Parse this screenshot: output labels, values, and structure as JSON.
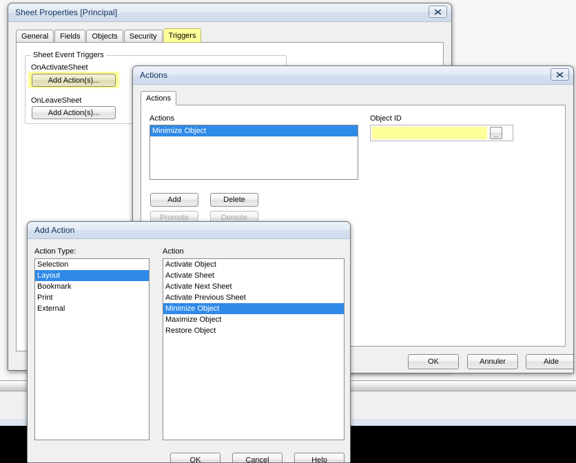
{
  "sheet_properties": {
    "title": "Sheet Properties [Principal]",
    "close_icon": "close-icon",
    "tabs": [
      {
        "label": "General",
        "selected": false,
        "highlight": false
      },
      {
        "label": "Fields",
        "selected": false,
        "highlight": false
      },
      {
        "label": "Objects",
        "selected": false,
        "highlight": false
      },
      {
        "label": "Security",
        "selected": false,
        "highlight": false
      },
      {
        "label": "Triggers",
        "selected": true,
        "highlight": true
      }
    ],
    "group_title": "Sheet Event Triggers",
    "triggers": [
      {
        "label": "OnActivateSheet",
        "button": "Add Action(s)...",
        "highlight": true
      },
      {
        "label": "OnLeaveSheet",
        "button": "Add Action(s)...",
        "highlight": false
      }
    ]
  },
  "actions_dialog": {
    "title": "Actions",
    "close_icon": "close-icon",
    "tabs": [
      {
        "label": "Actions",
        "selected": true
      }
    ],
    "actions_label": "Actions",
    "actions_list": [
      {
        "label": "Minimize Object",
        "selected": true
      }
    ],
    "object_id_label": "Object ID",
    "object_id_value": "",
    "object_id_placeholder": "",
    "browse_button": "...",
    "buttons": [
      {
        "label": "Add",
        "enabled": true
      },
      {
        "label": "Delete",
        "enabled": true
      },
      {
        "label": "Promote",
        "enabled": false
      },
      {
        "label": "Demote",
        "enabled": false
      }
    ],
    "footer_buttons": [
      {
        "label": "OK"
      },
      {
        "label": "Annuler"
      },
      {
        "label": "Aide"
      }
    ]
  },
  "add_action_dialog": {
    "title": "Add Action",
    "action_type_label": "Action Type:",
    "action_label": "Action",
    "action_types": [
      {
        "label": "Selection",
        "selected": false
      },
      {
        "label": "Layout",
        "selected": true
      },
      {
        "label": "Bookmark",
        "selected": false
      },
      {
        "label": "Print",
        "selected": false
      },
      {
        "label": "External",
        "selected": false
      }
    ],
    "actions": [
      {
        "label": "Activate Object",
        "selected": false
      },
      {
        "label": "Activate Sheet",
        "selected": false
      },
      {
        "label": "Activate Next Sheet",
        "selected": false
      },
      {
        "label": "Activate Previous Sheet",
        "selected": false
      },
      {
        "label": "Minimize Object",
        "selected": true
      },
      {
        "label": "Maximize Object",
        "selected": false
      },
      {
        "label": "Restore Object",
        "selected": false
      }
    ],
    "footer_buttons": [
      {
        "label": "OK"
      },
      {
        "label": "Cancel"
      },
      {
        "label": "Help"
      }
    ]
  },
  "colors": {
    "selection_blue": "#2f8ae8",
    "highlight_yellow": "#ffff99",
    "window_face": "#f0f0f0",
    "title_text": "#11305c",
    "desktop_black": "#000000"
  }
}
